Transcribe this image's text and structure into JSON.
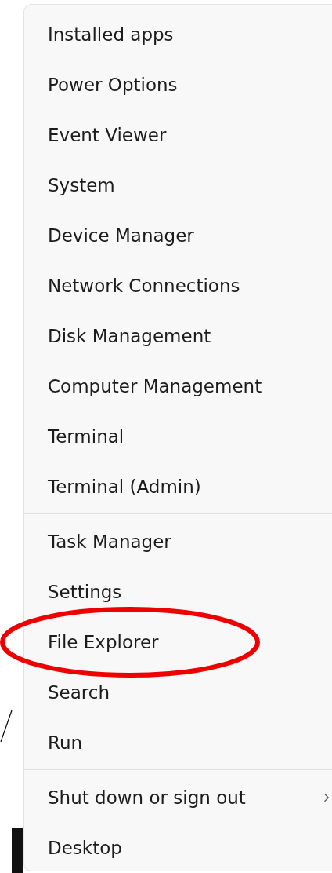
{
  "menu": {
    "groups": [
      {
        "items": [
          {
            "label": "Installed apps",
            "submenu": false,
            "circled": false
          },
          {
            "label": "Power Options",
            "submenu": false,
            "circled": false
          },
          {
            "label": "Event Viewer",
            "submenu": false,
            "circled": false
          },
          {
            "label": "System",
            "submenu": false,
            "circled": false
          },
          {
            "label": "Device Manager",
            "submenu": false,
            "circled": false
          },
          {
            "label": "Network Connections",
            "submenu": false,
            "circled": false
          },
          {
            "label": "Disk Management",
            "submenu": false,
            "circled": false
          },
          {
            "label": "Computer Management",
            "submenu": false,
            "circled": false
          },
          {
            "label": "Terminal",
            "submenu": false,
            "circled": false
          },
          {
            "label": "Terminal (Admin)",
            "submenu": false,
            "circled": false
          }
        ]
      },
      {
        "items": [
          {
            "label": "Task Manager",
            "submenu": false,
            "circled": false
          },
          {
            "label": "Settings",
            "submenu": false,
            "circled": false
          },
          {
            "label": "File Explorer",
            "submenu": false,
            "circled": true
          },
          {
            "label": "Search",
            "submenu": false,
            "circled": false
          },
          {
            "label": "Run",
            "submenu": false,
            "circled": false
          }
        ]
      },
      {
        "items": [
          {
            "label": "Shut down or sign out",
            "submenu": true,
            "circled": false
          },
          {
            "label": "Desktop",
            "submenu": false,
            "circled": false
          }
        ]
      }
    ]
  }
}
